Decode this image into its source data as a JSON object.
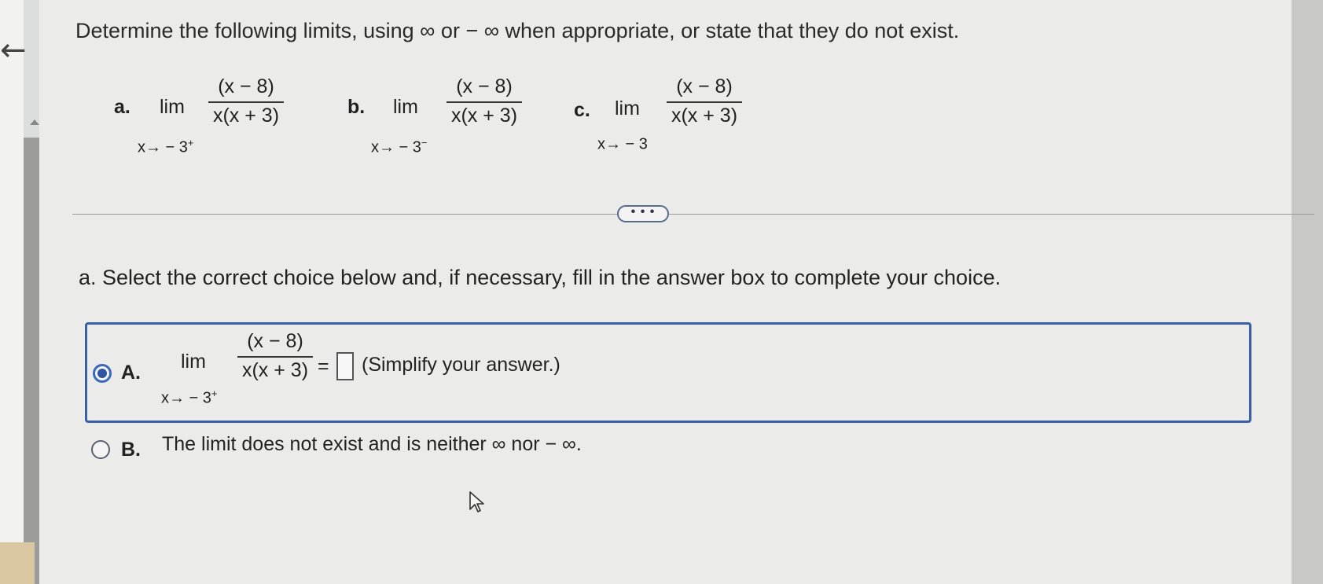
{
  "instruction": "Determine the following limits, using ∞ or − ∞ when appropriate, or state that they do not exist.",
  "problems": [
    {
      "label": "a.",
      "lim": "lim",
      "approach": "x→ − 3",
      "side": "+",
      "numerator": "(x − 8)",
      "denominator": "x(x + 3)"
    },
    {
      "label": "b.",
      "lim": "lim",
      "approach": "x→ − 3",
      "side": "−",
      "numerator": "(x − 8)",
      "denominator": "x(x + 3)"
    },
    {
      "label": "c.",
      "lim": "lim",
      "approach": "x→ − 3",
      "side": "",
      "numerator": "(x − 8)",
      "denominator": "x(x + 3)"
    }
  ],
  "more_button": "• • •",
  "part_a_prompt": "a. Select the correct choice below and, if necessary, fill in the answer box to complete your choice.",
  "choices": [
    {
      "letter": "A.",
      "selected": true,
      "lim": "lim",
      "approach": "x→ − 3",
      "side": "+",
      "numerator": "(x − 8)",
      "denominator": "x(x + 3)",
      "equals": "=",
      "answer_value": "",
      "hint": "(Simplify your answer.)"
    },
    {
      "letter": "B.",
      "selected": false,
      "text": "The limit does not exist and is neither ∞ nor − ∞."
    }
  ],
  "icons": {
    "back": "back-arrow-icon",
    "cursor": "mouse-pointer-icon"
  },
  "colors": {
    "accent": "#3a5fa6",
    "radio_fill": "#2f55a0"
  }
}
